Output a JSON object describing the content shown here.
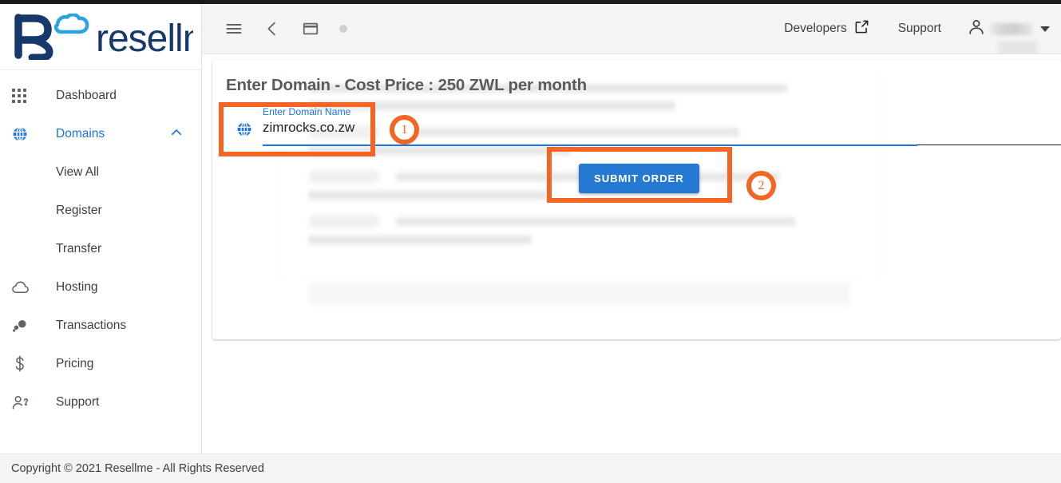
{
  "brand": {
    "name": "resellme",
    "logo_mark": "cloud-r-logo",
    "primary_blue": "#1a73e8",
    "logo_dark": "#15396b",
    "logo_light": "#2aa4e0"
  },
  "sidebar": {
    "items": [
      {
        "label": "Dashboard",
        "icon": "grid-apps-icon",
        "active": false,
        "type": "item"
      },
      {
        "label": "Domains",
        "icon": "globe-icon",
        "active": true,
        "type": "item",
        "expanded": true,
        "chevron": "chevron-up-icon"
      },
      {
        "label": "View All",
        "icon": "",
        "active": false,
        "type": "sub"
      },
      {
        "label": "Register",
        "icon": "",
        "active": false,
        "type": "sub"
      },
      {
        "label": "Transfer",
        "icon": "",
        "active": false,
        "type": "sub"
      },
      {
        "label": "Hosting",
        "icon": "cloud-icon",
        "active": false,
        "type": "item"
      },
      {
        "label": "Transactions",
        "icon": "bubbles-icon",
        "active": false,
        "type": "item"
      },
      {
        "label": "Pricing",
        "icon": "dollar-icon",
        "active": false,
        "type": "item"
      },
      {
        "label": "Support",
        "icon": "person-question-icon",
        "active": false,
        "type": "item"
      }
    ]
  },
  "header": {
    "menu_icon": "hamburger-menu-icon",
    "back_icon": "chevron-left-icon",
    "window_icon": "window-icon",
    "dot_icon": "dot-indicator-icon",
    "developers_label": "Developers",
    "developers_icon": "external-link-icon",
    "support_label": "Support",
    "account_icon": "person-icon",
    "account_name": "",
    "account_caret": "caret-down-icon"
  },
  "main": {
    "card_title": "Enter Domain - Cost Price : 250 ZWL per month",
    "domain_field": {
      "icon": "globe-icon",
      "label": "Enter Domain Name",
      "value": "zimrocks.co.zw",
      "placeholder": "Enter Domain Name"
    },
    "submit_label": "SUBMIT ORDER",
    "submit_color": "#2679d2"
  },
  "footer": {
    "copyright": "Copyright © 2021 Resellme - All Rights Reserved"
  },
  "annotations": {
    "color": "#f26522",
    "steps": [
      {
        "number": "1",
        "target": "domain-name-input"
      },
      {
        "number": "2",
        "target": "submit-order-button"
      }
    ]
  }
}
